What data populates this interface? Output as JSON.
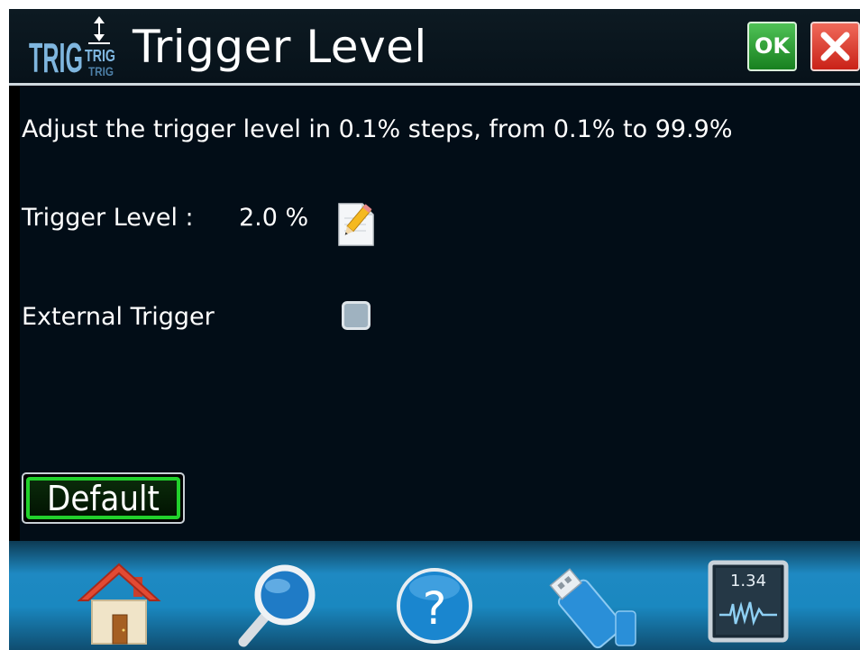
{
  "header": {
    "logo_text": "TRIG TRIG",
    "title": "Trigger Level",
    "ok_label": "OK",
    "close_icon": "close-icon"
  },
  "content": {
    "description": "Adjust the trigger level in 0.1% steps, from 0.1% to 99.9%",
    "trigger_level_label": "Trigger Level :",
    "trigger_level_value": "2.0 %",
    "edit_icon": "edit-pencil-icon",
    "external_trigger_label": "External Trigger",
    "external_trigger_checked": false,
    "default_button_label": "Default"
  },
  "footer": {
    "items": [
      {
        "name": "home",
        "icon": "home-icon"
      },
      {
        "name": "search",
        "icon": "search-icon"
      },
      {
        "name": "help",
        "icon": "help-icon",
        "glyph": "?"
      },
      {
        "name": "usb",
        "icon": "usb-drive-icon"
      },
      {
        "name": "measurement",
        "icon": "measurement-display-icon",
        "value": "1.34"
      }
    ]
  },
  "colors": {
    "background": "#020d17",
    "ok_green": "#2fa336",
    "close_red": "#e0392b",
    "default_border": "#22d12c",
    "footer_blue": "#1e89c2"
  }
}
